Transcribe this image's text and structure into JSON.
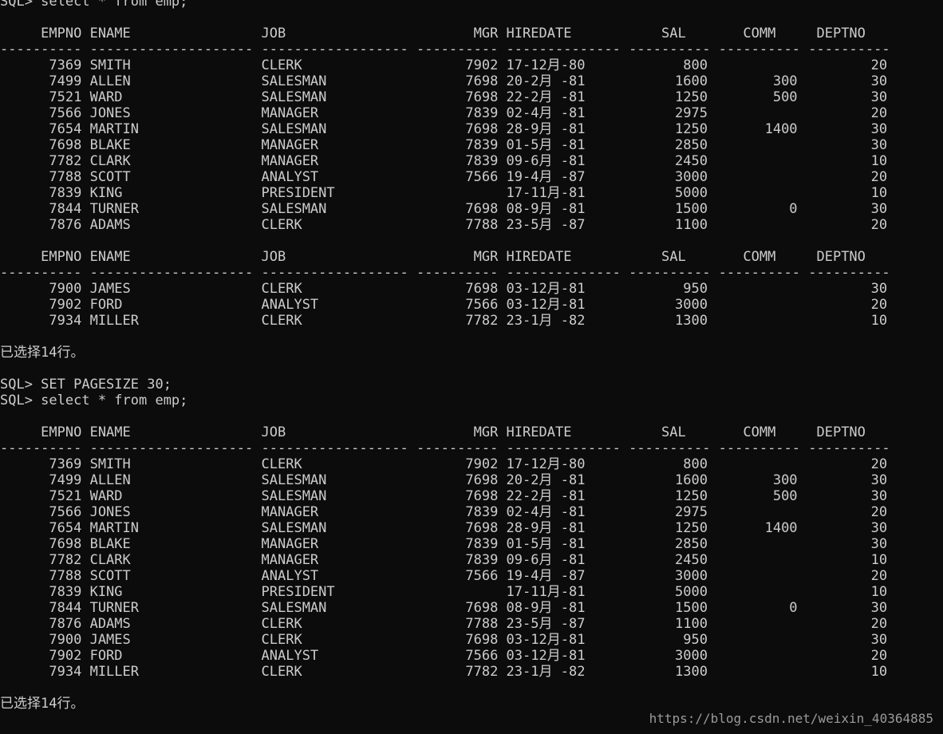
{
  "lines": [
    "SQL> select * from emp;",
    "",
    "     EMPNO ENAME                JOB                       MGR HIRDATE            SAL       COMM     DEPTNO",
    "---------- -------------------- ------------------ ---------- -------------- ---------- ---------- ----------",
    "      7369 SMITH                CLERK                    7902 17-12月-80            800                    20",
    "      7499 ALLEN                SALESMAN                 7698 20-2月 -81           1600        300         30",
    "      7521 WARD                 SALESMAN                 7698 22-2月 -81           1250        500         30",
    "      7566 JONES                MANAGER                  7839 02-4月 -81           2975                    20",
    "      7654 MARTIN               SALESMAN                 7698 28-9月 -81           1250       1400         30",
    "      7698 BLAKE                MANAGER                  7839 01-5月 -81           2850                    30",
    "      7782 CLARK                MANAGER                  7839 09-6月 -81           2450                    10",
    "      7788 SCOTT                ANALYST                  7566 19-4月 -87           3000                    20",
    "      7839 KING                 PRESIDENT                     17-11月-81           5000                    10",
    "      7844 TURNER               SALESMAN                 7698 08-9月 -81           1500          0         30",
    "      7876 ADAMS                CLERK                    7788 23-5月 -87           1100                    20",
    "",
    "     EMPNO ENAME                JOB                       MGR HIRDATE            SAL       COMM     DEPTNO",
    "---------- -------------------- ------------------ ---------- -------------- ---------- ---------- ----------",
    "      7900 JAMES                CLERK                    7698 03-12月-81            950                    30",
    "      7902 FORD                 ANALYST                  7566 03-12月-81           3000                    20",
    "      7934 MILLER               CLERK                    7782 23-1月 -82           1300                    10",
    "",
    "已选择14行。",
    "",
    "SQL> SET PAGESIZE 30;",
    "SQL> select * from emp;",
    "",
    "     EMPNO ENAME                JOB                       MGR HIRDATE            SAL       COMM     DEPTNO",
    "---------- -------------------- ------------------ ---------- -------------- ---------- ---------- ----------",
    "      7369 SMITH                CLERK                    7902 17-12月-80            800                    20",
    "      7499 ALLEN                SALESMAN                 7698 20-2月 -81           1600        300         30",
    "      7521 WARD                 SALESMAN                 7698 22-2月 -81           1250        500         30",
    "      7566 JONES                MANAGER                  7839 02-4月 -81           2975                    20",
    "      7654 MARTIN               SALESMAN                 7698 28-9月 -81           1250       1400         30",
    "      7698 BLAKE                MANAGER                  7839 01-5月 -81           2850                    30",
    "      7782 CLARK                MANAGER                  7839 09-6月 -81           2450                    10",
    "      7788 SCOTT                ANALYST                  7566 19-4月 -87           3000                    20",
    "      7839 KING                 PRESIDENT                     17-11月-81           5000                    10",
    "      7844 TURNER               SALESMAN                 7698 08-9月 -81           1500          0         30",
    "      7876 ADAMS                CLERK                    7788 23-5月 -87           1100                    20",
    "      7900 JAMES                CLERK                    7698 03-12月-81            950                    30",
    "      7902 FORD                 ANALYST                  7566 03-12月-81           3000                    20",
    "      7934 MILLER               CLERK                    7782 23-1月 -82           1300                    10",
    "",
    "已选择14行。"
  ],
  "watermark": "https://blog.csdn.net/weixin_40364885",
  "colors": {
    "background": "#0c0c0c",
    "text": "#cccccc"
  }
}
